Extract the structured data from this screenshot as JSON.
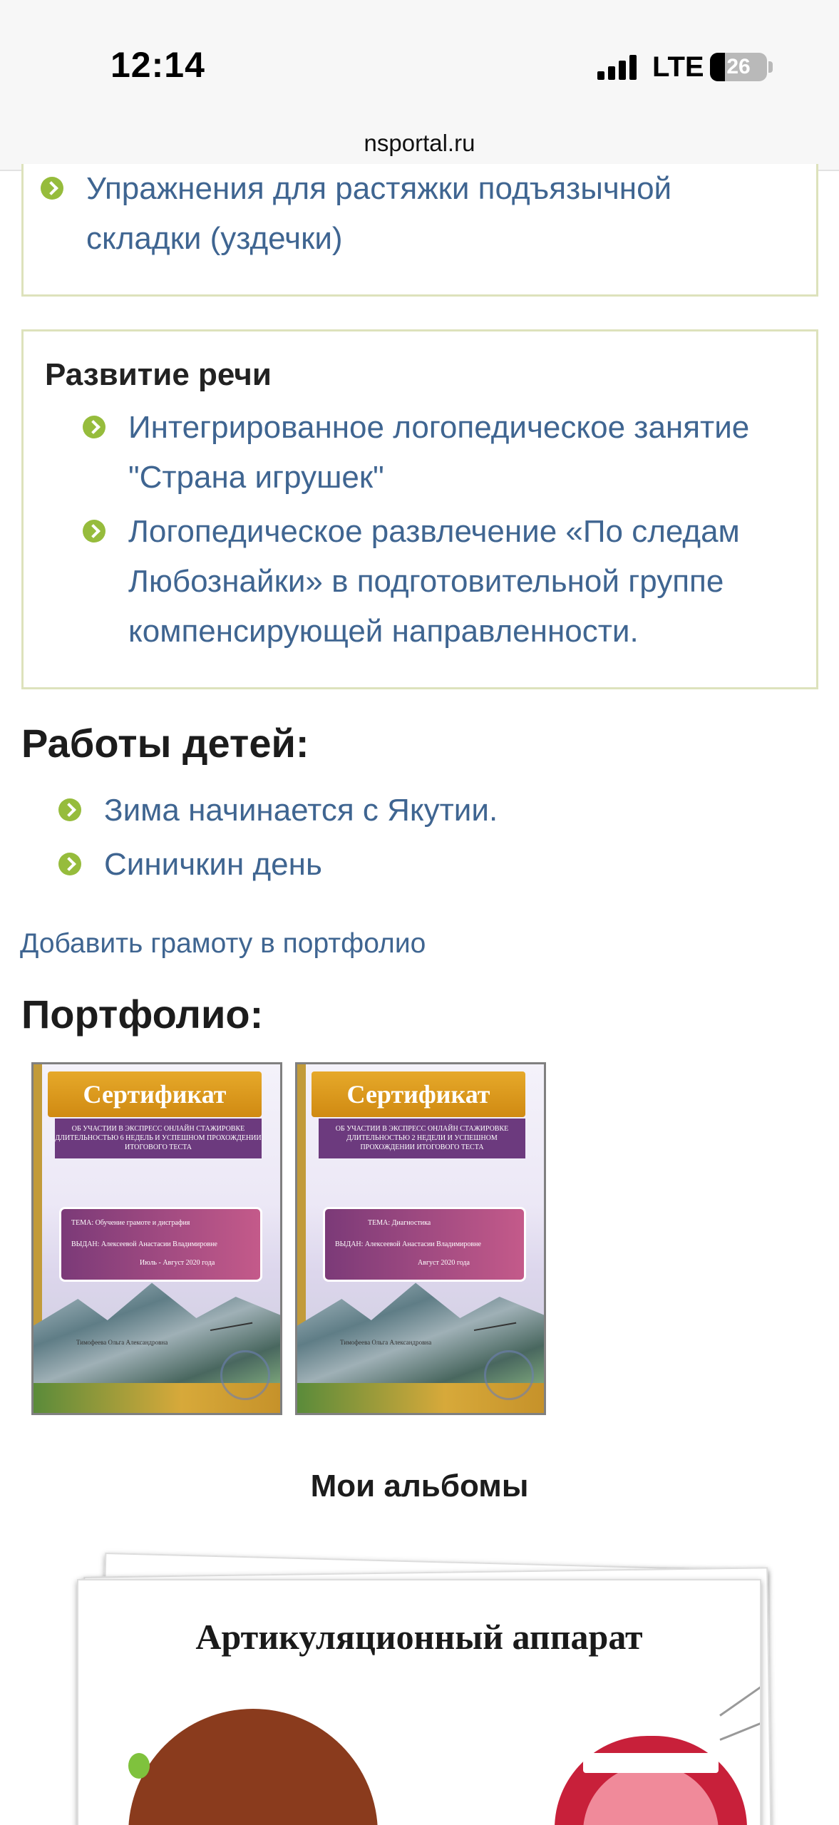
{
  "status_bar": {
    "time": "12:14",
    "network": "LTE",
    "battery": "26",
    "battery_level": 0.26
  },
  "address_bar": {
    "url": "nsportal.ru"
  },
  "top_box": {
    "items": [
      {
        "label": "Упражнения для растяжки подъязычной складки (уздечки)"
      }
    ]
  },
  "speech_box": {
    "title": "Развитие речи",
    "items": [
      {
        "label": "Интегрированное логопедическое занятие \"Страна игрушек\""
      },
      {
        "label": "Логопедическое развлечение «По следам Любознайки» в подготовительной группе компенсирующей направленности."
      }
    ]
  },
  "children_works": {
    "heading": "Работы детей:",
    "items": [
      {
        "label": "Зима начинается с Якутии."
      },
      {
        "label": "Синичкин день"
      }
    ]
  },
  "add_certificate_link": "Добавить грамоту в портфолио",
  "portfolio": {
    "heading": "Портфолио:",
    "certificates": [
      {
        "title": "Сертификат",
        "subtitle": "ОБ УЧАСТИИ В ЭКСПРЕСС ОНЛАЙН СТАЖИРОВКЕ ДЛИТЕЛЬНОСТЬЮ 6 НЕДЕЛЬ И УСПЕШНОМ ПРОХОЖДЕНИИ ИТОГОВОГО ТЕСТА",
        "topic": "ТЕМА: Обучение грамоте и дисграфия",
        "issued": "ВЫДАН: Алексеевой Анастасии Владимировне",
        "date": "Июль - Август 2020 года",
        "signer": "Тимофеева Ольга Александровна"
      },
      {
        "title": "Сертификат",
        "subtitle": "ОБ УЧАСТИИ В ЭКСПРЕСС ОНЛАЙН СТАЖИРОВКЕ ДЛИТЕЛЬНОСТЬЮ 2 НЕДЕЛИ И УСПЕШНОМ ПРОХОЖДЕНИИ ИТОГОВОГО ТЕСТА",
        "topic": "ТЕМА: Диагностика",
        "issued": "ВЫДАН: Алексеевой Анастасии Владимировне",
        "date": "Август 2020 года",
        "signer": "Тимофеева Ольга Александровна"
      }
    ]
  },
  "albums": {
    "heading": "Мои альбомы",
    "cover_title": "Артикуляционный аппарат"
  }
}
